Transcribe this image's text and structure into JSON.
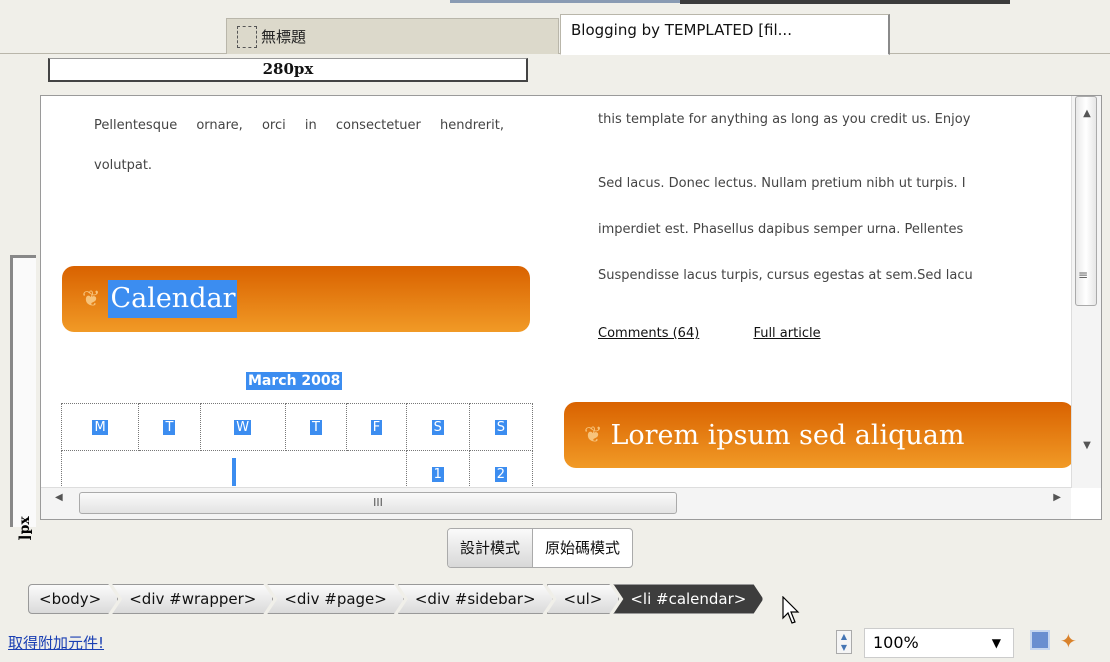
{
  "tabs": [
    {
      "label": "無標題",
      "active": false
    },
    {
      "label": "Blogging by TEMPLATED [fil...",
      "active": true
    }
  ],
  "ruler": {
    "horizontal_label": "280px",
    "vertical_label": "]px"
  },
  "document": {
    "left_paragraph": "Pellentesque ornare, orci in consectetuer hendrerit, volutpat.",
    "calendar_heading": "Calendar",
    "month": "March 2008",
    "weekdays": [
      "M",
      "T",
      "W",
      "T",
      "F",
      "S",
      "S"
    ],
    "first_row_dates": [
      "1",
      "2"
    ],
    "right_lines": [
      "this template for anything as long as you credit us. Enjoy",
      "Sed lacus. Donec lectus. Nullam pretium nibh ut turpis. I",
      "imperdiet est. Phasellus dapibus semper urna. Pellentes",
      "Suspendisse lacus turpis, cursus egestas at sem.Sed lacu"
    ],
    "comments_link": "Comments (64)",
    "full_article_link": "Full article",
    "lorem_heading": "Lorem ipsum sed aliquam"
  },
  "scroll_grip": "III",
  "modes": {
    "design": "設計模式",
    "code": "原始碼模式"
  },
  "tag_path": [
    "<body>",
    "<div #wrapper>",
    "<div #page>",
    "<div #sidebar>",
    "<ul>",
    "<li #calendar>"
  ],
  "status": {
    "addon_link": "取得附加元件!",
    "zoom": "100%"
  },
  "colors": {
    "accent": "#3c8df0",
    "heading_orange": "#e5740f"
  }
}
